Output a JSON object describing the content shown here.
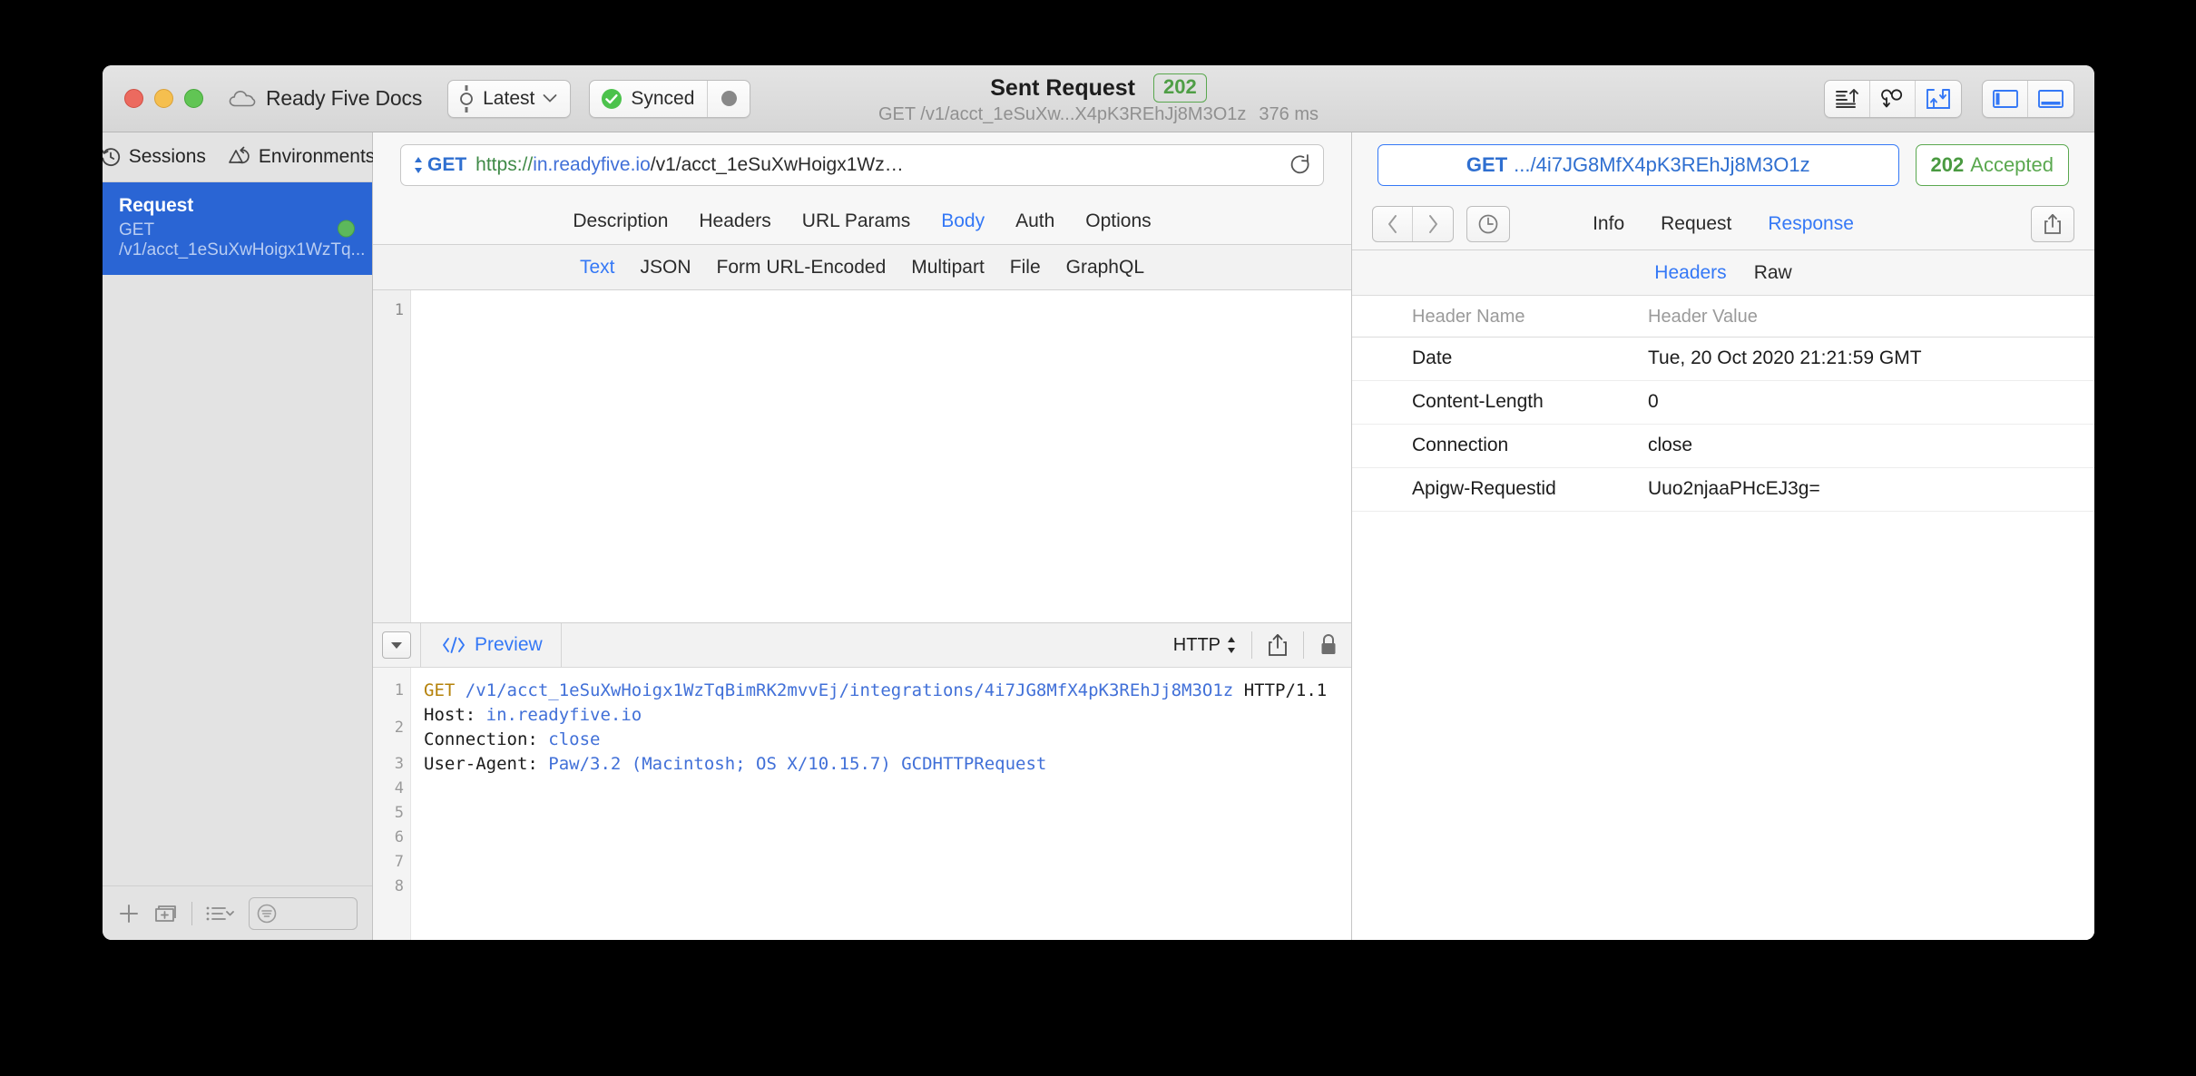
{
  "window": {
    "traffic_lights": [
      "close",
      "minimize",
      "zoom"
    ],
    "document_title": "Ready Five Docs",
    "environment": {
      "label": "Latest",
      "icon": "environment-icon"
    },
    "sync": {
      "label": "Synced",
      "icon": "check-circle-icon",
      "indicator": "activity-dot"
    },
    "center": {
      "title": "Sent Request",
      "status_code": "202",
      "subtitle": "GET /v1/acct_1eSuXw...X4pK3REhJj8M3O1z",
      "duration": "376 ms"
    },
    "toolbar_right": [
      {
        "name": "sort-icon"
      },
      {
        "name": "cookies-icon"
      },
      {
        "name": "import-export-icon"
      },
      {
        "name": "toggle-left-sidebar-icon"
      },
      {
        "name": "toggle-bottom-panel-icon"
      }
    ]
  },
  "sidebar": {
    "tabs": [
      {
        "label": "Sessions",
        "icon": "history-clock-icon",
        "active": true
      },
      {
        "label": "Environments",
        "icon": "environments-icon",
        "active": false
      }
    ],
    "items": [
      {
        "name": "Request",
        "subtitle": "GET /v1/acct_1eSuXwHoigx1WzTq...",
        "selected": true,
        "status": "success"
      }
    ],
    "bottom_toolbar": [
      {
        "name": "add-request-icon"
      },
      {
        "name": "add-group-icon"
      },
      {
        "name": "list-options-icon"
      }
    ],
    "filter_placeholder": ""
  },
  "request": {
    "url_bar": {
      "method": "GET",
      "url_scheme": "https://",
      "url_host": "in.readyfive.io",
      "url_path": "/v1/acct_1eSuXwHoigx1Wz…",
      "reload_icon": "reload-icon"
    },
    "tabs": [
      {
        "label": "Description",
        "active": false
      },
      {
        "label": "Headers",
        "active": false
      },
      {
        "label": "URL Params",
        "active": false
      },
      {
        "label": "Body",
        "active": true
      },
      {
        "label": "Auth",
        "active": false
      },
      {
        "label": "Options",
        "active": false
      }
    ],
    "body_tabs": [
      {
        "label": "Text",
        "active": true
      },
      {
        "label": "JSON",
        "active": false
      },
      {
        "label": "Form URL-Encoded",
        "active": false
      },
      {
        "label": "Multipart",
        "active": false
      },
      {
        "label": "File",
        "active": false
      },
      {
        "label": "GraphQL",
        "active": false
      }
    ],
    "editor": {
      "line_numbers": [
        "1"
      ],
      "content": ""
    },
    "preview_bar": {
      "collapse_icon": "collapse-triangle-icon",
      "preview_label": "Preview",
      "code_icon": "code-brackets-icon",
      "format_label": "HTTP",
      "share_icon": "share-icon",
      "lock_icon": "lock-icon"
    },
    "preview": {
      "line_numbers": [
        "1",
        "2",
        "3",
        "4",
        "5",
        "6",
        "7",
        "8"
      ],
      "lines": [
        {
          "method": "GET",
          "path": " /v1/acct_1eSuXwHoigx1WzTqBimRK2mvvEj/integrations/4i7JG8MfX4pK3REhJj8M3O1z",
          "version": " HTTP/1.1"
        },
        {
          "key": "Host:",
          "value": " in.readyfive.io"
        },
        {
          "key": "Connection:",
          "value": " close"
        },
        {
          "key": "User-Agent:",
          "value": " Paw/3.2 (Macintosh; OS X/10.15.7) GCDHTTPRequest"
        }
      ]
    }
  },
  "response": {
    "request_chip": {
      "method": "GET",
      "path": ".../4i7JG8MfX4pK3REhJj8M3O1z"
    },
    "status_chip": {
      "code": "202",
      "text": "Accepted"
    },
    "nav": {
      "back_icon": "chevron-left-icon",
      "forward_icon": "chevron-right-icon",
      "history_icon": "clock-icon",
      "share_icon": "share-icon"
    },
    "tabs": [
      {
        "label": "Info",
        "active": false
      },
      {
        "label": "Request",
        "active": false
      },
      {
        "label": "Response",
        "active": true
      }
    ],
    "sub_tabs": [
      {
        "label": "Headers",
        "active": true
      },
      {
        "label": "Raw",
        "active": false
      }
    ],
    "headers_table": {
      "columns": [
        "Header Name",
        "Header Value"
      ],
      "rows": [
        {
          "name": "Date",
          "value": "Tue, 20 Oct 2020 21:21:59 GMT"
        },
        {
          "name": "Content-Length",
          "value": "0"
        },
        {
          "name": "Connection",
          "value": "close"
        },
        {
          "name": "Apigw-Requestid",
          "value": "Uuo2njaaPHcEJ3g="
        }
      ]
    }
  },
  "colors": {
    "accent_blue": "#3478f6",
    "success_green": "#5aa84f",
    "selection_blue": "#2a65d4",
    "scheme_green": "#3f8a47",
    "host_blue": "#4170d8",
    "keyword_orange": "#b5820a"
  }
}
